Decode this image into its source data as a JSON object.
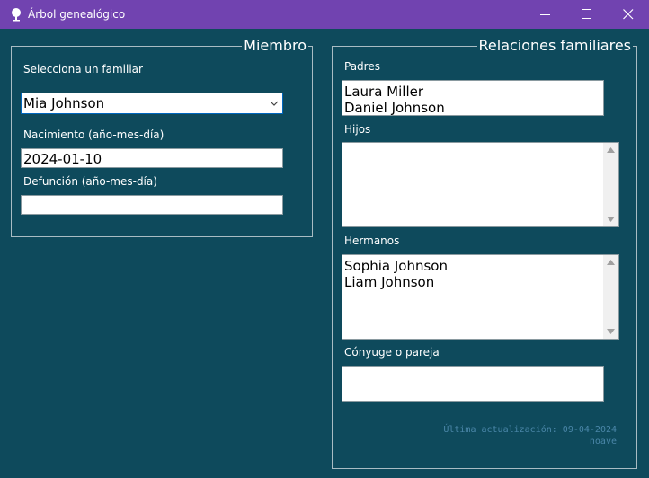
{
  "window": {
    "title": "Árbol genealógico",
    "controls": [
      "minimize",
      "maximize",
      "close"
    ]
  },
  "member_group": {
    "legend": "Miembro",
    "select_label": "Selecciona un familiar",
    "selected_member": "Mia Johnson",
    "birth_label": "Nacimiento (año-mes-día)",
    "birth_value": "2024-01-10",
    "death_label": "Defunción (año-mes-día)",
    "death_value": ""
  },
  "relations_group": {
    "legend": "Relaciones familiares",
    "parents_label": "Padres",
    "parents": [
      "Laura Miller",
      "Daniel Johnson"
    ],
    "children_label": "Hijos",
    "children": [],
    "siblings_label": "Hermanos",
    "siblings": [
      "Sophia Johnson",
      "Liam Johnson"
    ],
    "spouse_label": "Cónyuge o pareja",
    "spouse": ""
  },
  "footer": {
    "last_update": "Última actualización: 09-04-2024",
    "author": "noave"
  },
  "colors": {
    "titlebar": "#7143b0",
    "background": "#0e4a5c",
    "group_border": "#a9bcc3",
    "footer_text": "#4a86a8"
  },
  "icons": [
    "tree-icon",
    "minimize-icon",
    "maximize-icon",
    "close-icon",
    "chevron-down-icon",
    "scroll-up-icon",
    "scroll-down-icon"
  ]
}
